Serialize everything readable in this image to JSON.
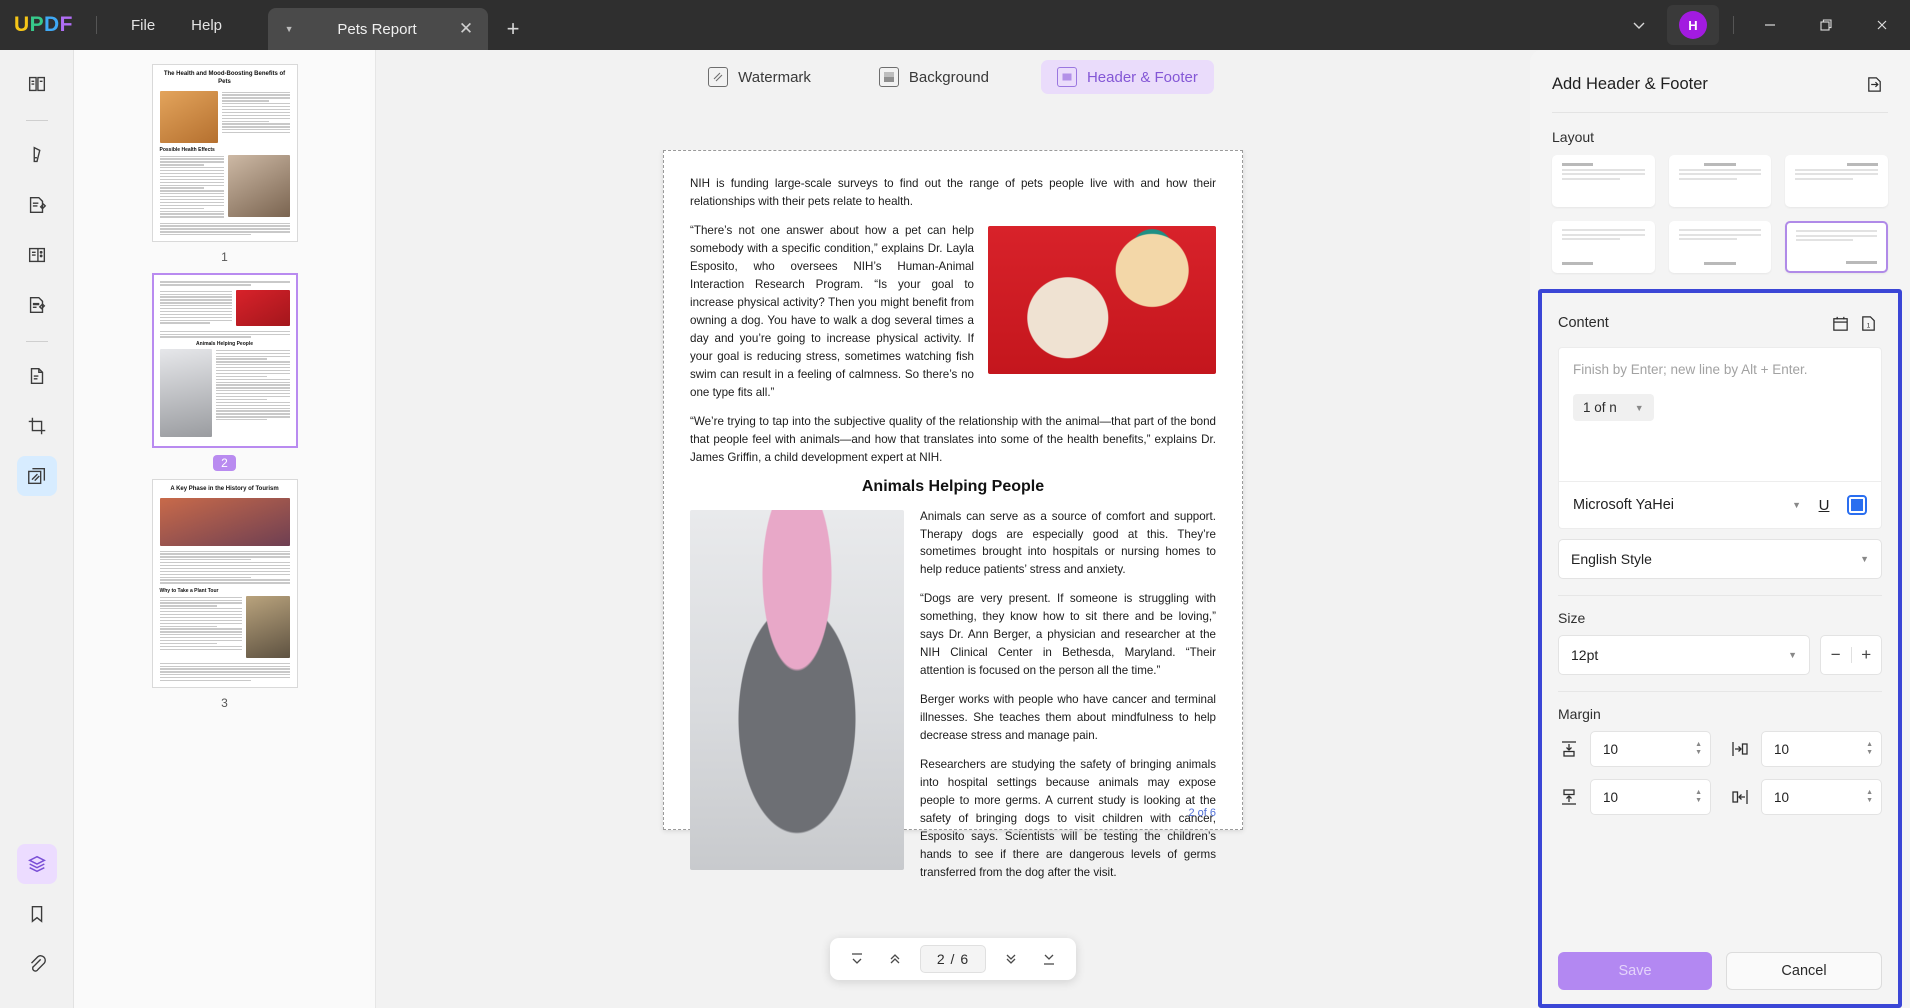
{
  "titlebar": {
    "logo_letters": [
      "U",
      "P",
      "D",
      "F"
    ],
    "menus": [
      {
        "label": "File",
        "name": "menu-file"
      },
      {
        "label": "Help",
        "name": "menu-help"
      }
    ],
    "tab": {
      "title": "Pets Report",
      "caret_icon": "chevron-down-icon",
      "close_icon": "close-icon"
    },
    "new_tab_icon": "plus-icon",
    "chevron_icon": "chevron-down-icon",
    "avatar_letter": "H",
    "minimize_icon": "minimize-icon",
    "maximize_icon": "maximize-icon",
    "close_icon": "close-icon"
  },
  "rail": {
    "items": [
      {
        "name": "reader-mode-icon",
        "label": "Reader"
      },
      {
        "name": "highlighter-icon",
        "label": "Comment"
      },
      {
        "name": "edit-pdf-icon",
        "label": "Edit PDF"
      },
      {
        "name": "organize-pages-icon",
        "label": "Page"
      },
      {
        "name": "form-icon",
        "label": "Form"
      },
      {
        "name": "convert-icon",
        "label": "Convert"
      },
      {
        "name": "crop-icon",
        "label": "Crop"
      },
      {
        "name": "watermark-icon",
        "label": "Protect"
      }
    ],
    "bottom_items": [
      {
        "name": "layers-icon",
        "label": "Layers"
      },
      {
        "name": "bookmark-icon",
        "label": "Bookmark"
      },
      {
        "name": "attachment-icon",
        "label": "Attachment"
      }
    ]
  },
  "thumbnails": [
    {
      "number": "1",
      "selected": false,
      "title": "The Health and Mood-Boosting Benefits of Pets",
      "subtitle": "Possible Health Effects"
    },
    {
      "number": "2",
      "selected": true,
      "title": "",
      "subtitle": "Animals Helping People"
    },
    {
      "number": "3",
      "selected": false,
      "title": "A Key Phase in the History of Tourism",
      "subtitle": "Why to Take a Plant Tour"
    }
  ],
  "tool_tabs": [
    {
      "label": "Watermark",
      "icon": "watermark-icon",
      "active": false
    },
    {
      "label": "Background",
      "icon": "background-icon",
      "active": false
    },
    {
      "label": "Header & Footer",
      "icon": "header-footer-icon",
      "active": true
    }
  ],
  "document": {
    "para1": "NIH is funding large-scale surveys to find out the range of pets people live with and how their relationships with their pets relate to health.",
    "para2": "“There’s not one answer about how a pet can help somebody with a specific condition,” explains Dr. Layla Esposito, who oversees NIH’s Human-Animal Interaction Research Program. “Is your goal to increase physical activity? Then you might benefit from owning a dog. You have to walk a dog several times a day and you’re going to increase physical activity. If your goal is reducing stress, sometimes watching fish swim can result in a feeling of calmness. So there’s no one type fits all.”",
    "para3": "“We’re trying to tap into the subjective quality of the relationship with the animal—that part of the bond that people feel with animals—and how that translates into some of the health benefits,” explains Dr. James Griffin, a child development expert at NIH.",
    "heading": "Animals Helping People",
    "para4": "Animals can serve as a source of comfort and support. Therapy dogs are especially good at this. They’re sometimes brought into hospitals or nursing homes to help reduce patients’ stress and anxiety.",
    "para5": "“Dogs are very present. If someone is struggling with something, they know how to sit there and be loving,” says Dr. Ann Berger, a physician and researcher at the NIH Clinical Center in Bethesda, Maryland. “Their attention is focused on the person all the time.”",
    "para6": "Berger works with people who have cancer and terminal illnesses. She teaches them about mindfulness to help decrease stress and manage pain.",
    "para7": "Researchers are studying the safety of bringing animals into hospital settings because animals may expose people to more germs. A current study is looking at the safety of bringing dogs to visit children with cancer, Esposito says. Scientists will be testing the children’s hands to see if there are dangerous levels of germs transferred from the dog after the visit.",
    "footer_text": "2 of 6"
  },
  "page_nav": {
    "first_icon": "first-page-icon",
    "prev_icon": "previous-page-icon",
    "value": "2 / 6",
    "next_icon": "next-page-icon",
    "last_icon": "last-page-icon"
  },
  "right_panel": {
    "title": "Add Header & Footer",
    "expand_icon": "apply-to-pages-icon",
    "layout_label": "Layout",
    "layouts": [
      {
        "name": "layout-header-left",
        "selected": false,
        "position": "top",
        "align": "left"
      },
      {
        "name": "layout-header-center",
        "selected": false,
        "position": "top",
        "align": "center"
      },
      {
        "name": "layout-header-right",
        "selected": false,
        "position": "top",
        "align": "right"
      },
      {
        "name": "layout-footer-left",
        "selected": false,
        "position": "bottom",
        "align": "left"
      },
      {
        "name": "layout-footer-center",
        "selected": false,
        "position": "bottom",
        "align": "center"
      },
      {
        "name": "layout-footer-right",
        "selected": true,
        "position": "bottom",
        "align": "right"
      }
    ],
    "content": {
      "label": "Content",
      "date_icon": "calendar-icon",
      "pagenum_icon": "page-number-icon",
      "placeholder": "Finish by Enter; new line by Alt + Enter.",
      "token": "1 of n",
      "token_caret": "chevron-down-icon",
      "font_name": "Microsoft YaHei",
      "font_caret": "chevron-down-icon",
      "underline_label": "U",
      "color_swatch": "#2a6ef0",
      "style": "English Style",
      "style_caret": "chevron-down-icon"
    },
    "size": {
      "label": "Size",
      "value": "12pt",
      "caret": "chevron-down-icon",
      "minus": "−",
      "plus": "+"
    },
    "margin": {
      "label": "Margin",
      "top": {
        "icon": "margin-top-icon",
        "value": "10"
      },
      "left": {
        "icon": "margin-left-icon",
        "value": "10"
      },
      "bottom": {
        "icon": "margin-bottom-icon",
        "value": "10"
      },
      "right": {
        "icon": "margin-right-icon",
        "value": "10"
      }
    },
    "save_label": "Save",
    "cancel_label": "Cancel"
  }
}
